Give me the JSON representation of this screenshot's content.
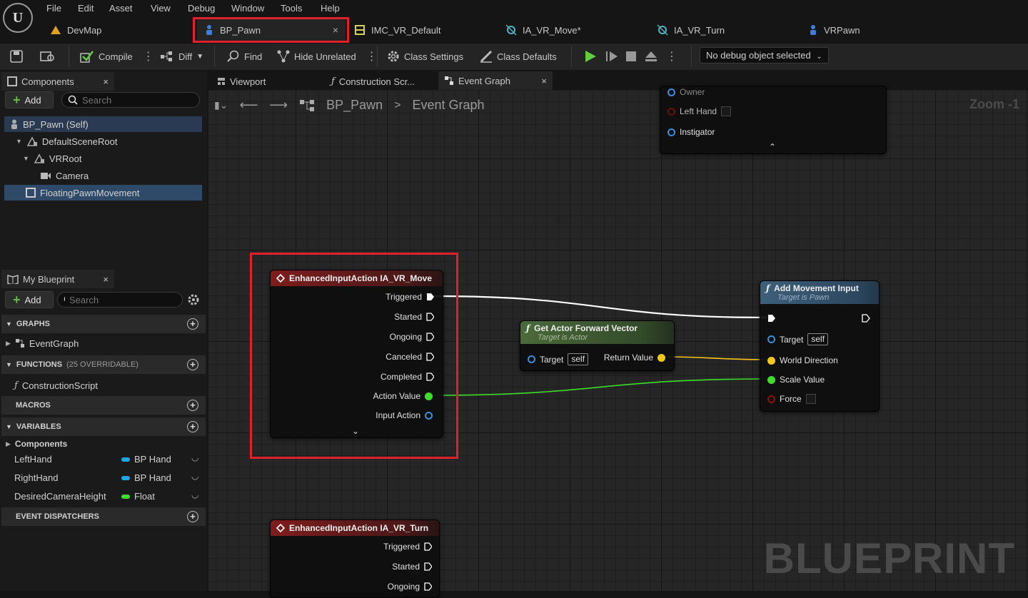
{
  "menu": [
    "File",
    "Edit",
    "Asset",
    "View",
    "Debug",
    "Window",
    "Tools",
    "Help"
  ],
  "doc_tabs": [
    {
      "label": "DevMap"
    },
    {
      "label": "BP_Pawn",
      "close": "×"
    },
    {
      "label": "IMC_VR_Default"
    },
    {
      "label": "IA_VR_Move*"
    },
    {
      "label": "IA_VR_Turn"
    },
    {
      "label": "VRPawn"
    }
  ],
  "toolbar": {
    "compile": "Compile",
    "diff": "Diff",
    "find": "Find",
    "hide_unrelated": "Hide Unrelated",
    "class_settings": "Class Settings",
    "class_defaults": "Class Defaults",
    "debug_object": "No debug object selected"
  },
  "components_panel": {
    "title": "Components",
    "close": "×",
    "add": "Add",
    "search_placeholder": "Search",
    "tree": [
      "BP_Pawn (Self)",
      "DefaultSceneRoot",
      "VRRoot",
      "Camera",
      "FloatingPawnMovement"
    ]
  },
  "my_blueprint": {
    "title": "My Blueprint",
    "close": "×",
    "add": "Add",
    "search_placeholder": "Search",
    "graphs_header": "GRAPHS",
    "event_graph": "EventGraph",
    "functions_header": "FUNCTIONS",
    "functions_note": "(25 OVERRIDABLE)",
    "construction_script": "ConstructionScript",
    "macros_header": "MACROS",
    "variables_header": "VARIABLES",
    "components_group": "Components",
    "variables": [
      {
        "name": "LeftHand",
        "type": "BP Hand",
        "color": "#1ba7e8"
      },
      {
        "name": "RightHand",
        "type": "BP Hand",
        "color": "#1ba7e8"
      },
      {
        "name": "DesiredCameraHeight",
        "type": "Float",
        "color": "#3edc2b"
      }
    ],
    "event_dispatchers_header": "EVENT DISPATCHERS"
  },
  "graph_tabs": [
    {
      "label": "Viewport"
    },
    {
      "label": "Construction Scr..."
    },
    {
      "label": "Event Graph",
      "close": "×"
    }
  ],
  "breadcrumb": {
    "root": "BP_Pawn",
    "sep": ">",
    "current": "Event Graph"
  },
  "zoom_label": "Zoom -1",
  "watermark": "BLUEPRINT",
  "top_node": {
    "owner": "Owner",
    "left_hand": "Left Hand",
    "instigator": "Instigator"
  },
  "node_move": {
    "title": "EnhancedInputAction IA_VR_Move",
    "pins": [
      "Triggered",
      "Started",
      "Ongoing",
      "Canceled",
      "Completed"
    ],
    "action_value": "Action Value",
    "input_action": "Input Action"
  },
  "node_forward": {
    "title": "Get Actor Forward Vector",
    "subtitle": "Target is Actor",
    "target": "Target",
    "self": "self",
    "return": "Return Value"
  },
  "node_add_move": {
    "title": "Add Movement Input",
    "subtitle": "Target is Pawn",
    "target": "Target",
    "self": "self",
    "world_direction": "World Direction",
    "scale_value": "Scale Value",
    "force": "Force"
  },
  "node_turn": {
    "title": "EnhancedInputAction IA_VR_Turn",
    "pins": [
      "Triggered",
      "Started",
      "Ongoing"
    ]
  },
  "colors": {
    "exec": "#ffffff",
    "vector": "#f5c518",
    "float": "#3edc2b",
    "object": "#3b8fd6",
    "bool": "#8a1010",
    "highlight": "#e0202a"
  }
}
